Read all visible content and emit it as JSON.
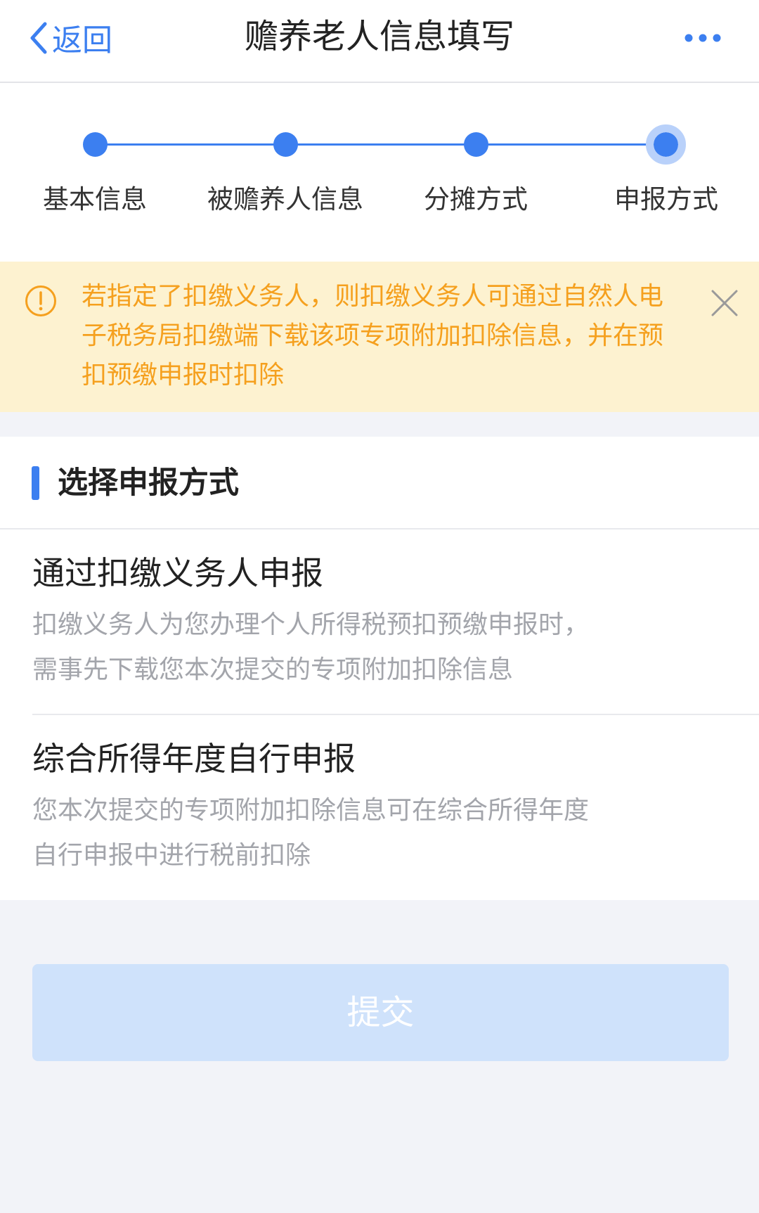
{
  "navbar": {
    "back_label": "返回",
    "title": "赡养老人信息填写",
    "back_icon": "chevron-left-icon",
    "more_icon": "more-dots-icon"
  },
  "stepper": {
    "steps": [
      {
        "label": "基本信息",
        "state": "done"
      },
      {
        "label": "被赡养人信息",
        "state": "done"
      },
      {
        "label": "分摊方式",
        "state": "done"
      },
      {
        "label": "申报方式",
        "state": "current"
      }
    ]
  },
  "notice": {
    "icon": "info-circle-icon",
    "text": "若指定了扣缴义务人，则扣缴义务人可通过自然人电子税务局扣缴端下载该项专项附加扣除信息，并在预扣预缴申报时扣除",
    "close_icon": "close-icon"
  },
  "section": {
    "title": "选择申报方式",
    "options": [
      {
        "title": "通过扣缴义务人申报",
        "description": "扣缴义务人为您办理个人所得税预扣预缴申报时，需事先下载您本次提交的专项附加扣除信息"
      },
      {
        "title": "综合所得年度自行申报",
        "description": "您本次提交的专项附加扣除信息可在综合所得年度自行申报中进行税前扣除"
      }
    ]
  },
  "submit": {
    "label": "提交",
    "state": "disabled"
  },
  "colors": {
    "accent": "#3c7ff0",
    "notice_bg": "#fdf2d0",
    "notice_text": "#f5a01e",
    "submit_disabled_bg": "#cfe2fb",
    "page_bg": "#f2f3f8"
  }
}
